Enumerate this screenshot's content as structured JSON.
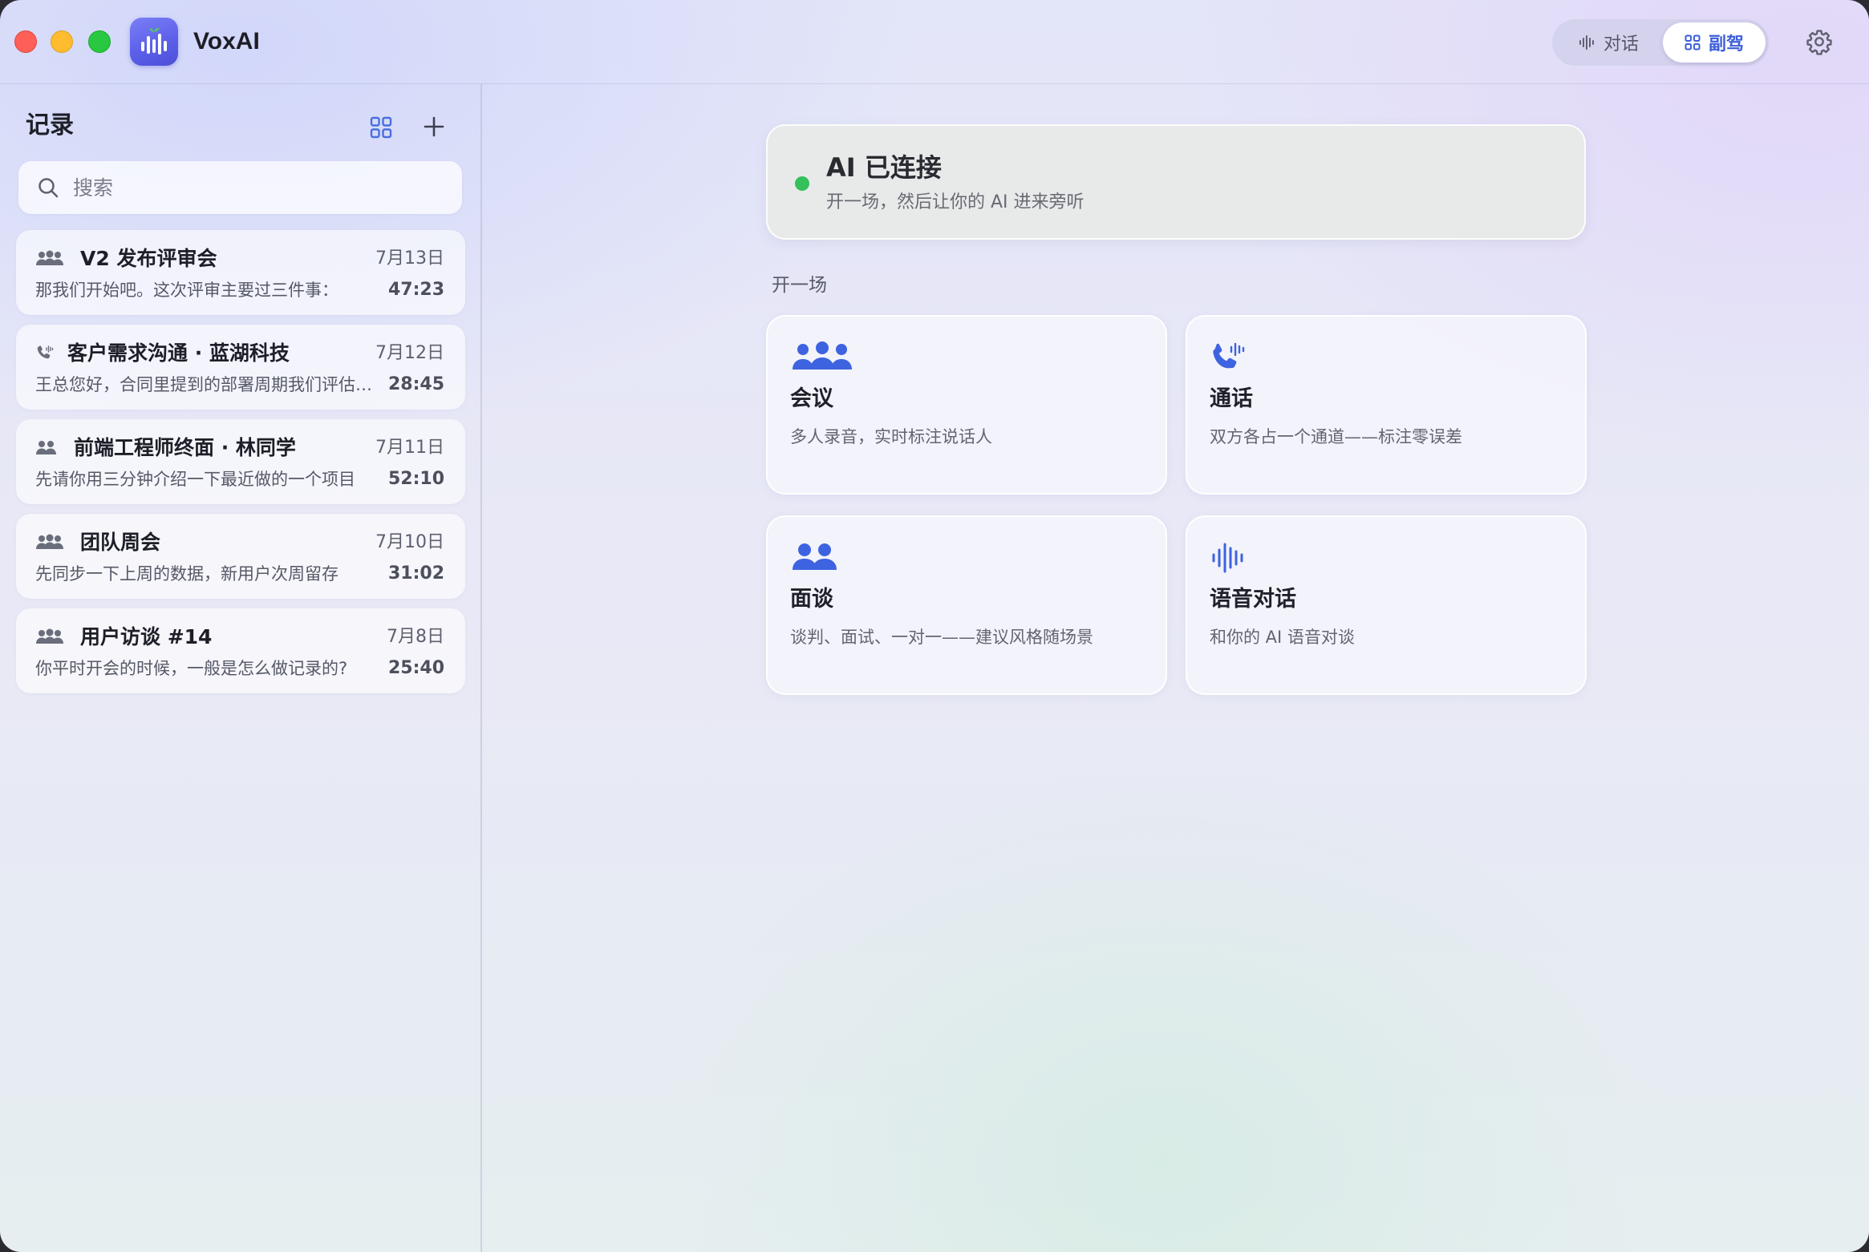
{
  "app": {
    "name": "VoxAI"
  },
  "header": {
    "modes": [
      {
        "label": "对话",
        "icon": "waveform-icon",
        "active": false
      },
      {
        "label": "副驾",
        "icon": "grid-icon",
        "active": true
      }
    ],
    "settings_icon": "gear-icon"
  },
  "sidebar": {
    "title": "记录",
    "search_placeholder": "搜索",
    "records": [
      {
        "title": "V2 发布评审会",
        "type": "meeting",
        "date": "7月13日",
        "preview": "那我们开始吧。这次评审主要过三件事：",
        "duration": "47:23"
      },
      {
        "title": "客户需求沟通 · 蓝湖科技",
        "type": "call",
        "date": "7月12日",
        "preview": "王总您好，合同里提到的部署周期我们评估过了",
        "duration": "28:45"
      },
      {
        "title": "前端工程师终面 · 林同学",
        "type": "interview",
        "date": "7月11日",
        "preview": "先请你用三分钟介绍一下最近做的一个项目",
        "duration": "52:10"
      },
      {
        "title": "团队周会",
        "type": "meeting",
        "date": "7月10日",
        "preview": "先同步一下上周的数据，新用户次周留存",
        "duration": "31:02"
      },
      {
        "title": "用户访谈 #14",
        "type": "meeting",
        "date": "7月8日",
        "preview": "你平时开会的时候，一般是怎么做记录的?",
        "duration": "25:40"
      }
    ]
  },
  "main": {
    "status": {
      "title": "AI 已连接",
      "subtitle": "开一场，然后让你的 AI 进来旁听",
      "color": "#34c05a"
    },
    "section_label": "开一场",
    "cards": [
      {
        "title": "会议",
        "desc": "多人录音，实时标注说话人",
        "icon": "group-icon"
      },
      {
        "title": "通话",
        "desc": "双方各占一个通道——标注零误差",
        "icon": "phone-wave-icon"
      },
      {
        "title": "面谈",
        "desc": "谈判、面试、一对一——建议风格随场景",
        "icon": "two-people-icon"
      },
      {
        "title": "语音对话",
        "desc": "和你的 AI 语音对谈",
        "icon": "waveform-icon"
      }
    ],
    "accent_color": "#3d63e0"
  }
}
